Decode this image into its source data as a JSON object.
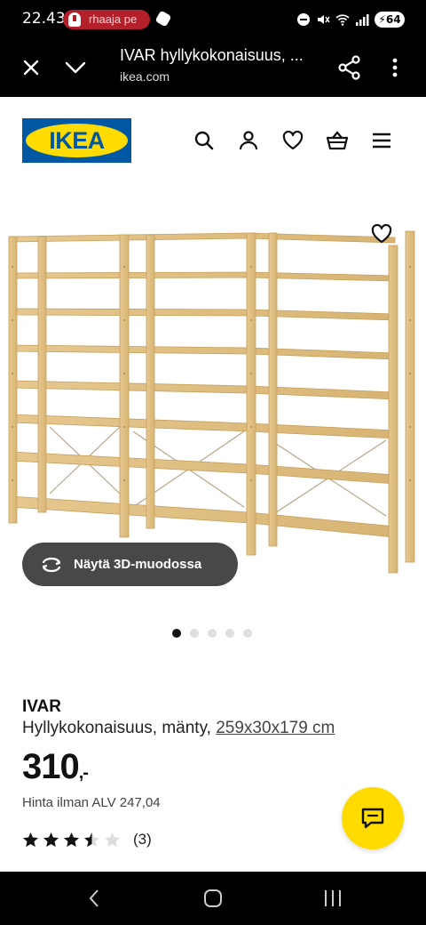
{
  "status_bar": {
    "time": "22.43",
    "notification_text": "rhaaja pe",
    "battery": "64"
  },
  "browser": {
    "title": "IVAR hyllykokonaisuus, ...",
    "url": "ikea.com"
  },
  "header": {
    "logo_text": "IKEA",
    "icons": [
      "search-icon",
      "user-icon",
      "heart-icon",
      "basket-icon",
      "menu-icon"
    ]
  },
  "gallery": {
    "button_3d_label": "Näytä 3D-muodossa",
    "image_count": 5,
    "active_index": 0
  },
  "product": {
    "name": "IVAR",
    "description": "Hyllykokonaisuus, mänty,",
    "dimensions": "259x30x179 cm",
    "price": "310",
    "price_suffix": ",-",
    "vat_text": "Hinta ilman ALV 247,04",
    "rating": 3.5,
    "rating_max": 5,
    "review_count": "(3)"
  },
  "colors": {
    "ikea_blue": "#0058a3",
    "ikea_yellow": "#ffdb00",
    "button_dark": "#484848"
  }
}
